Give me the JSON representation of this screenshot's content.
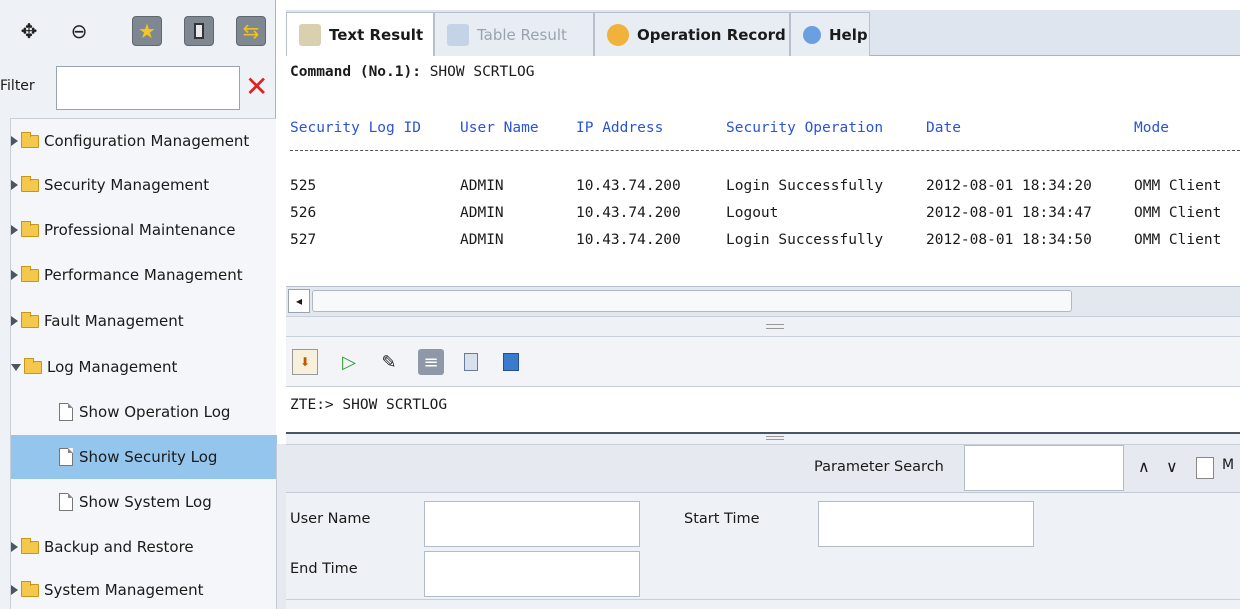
{
  "left_toolbar": {
    "icons": [
      "expand-icon",
      "collapse-icon",
      "favorites-icon",
      "device-icon",
      "switch-icon"
    ]
  },
  "filter": {
    "label": "Filter",
    "value": ""
  },
  "tree": [
    {
      "label": "Configuration Management",
      "type": "folder",
      "expanded": false
    },
    {
      "label": "Security Management",
      "type": "folder",
      "expanded": false
    },
    {
      "label": "Professional Maintenance",
      "type": "folder",
      "expanded": false
    },
    {
      "label": "Performance Management",
      "type": "folder",
      "expanded": false
    },
    {
      "label": "Fault Management",
      "type": "folder",
      "expanded": false
    },
    {
      "label": "Log Management",
      "type": "folder",
      "expanded": true
    },
    {
      "label": "Show Operation Log",
      "type": "doc"
    },
    {
      "label": "Show Security Log",
      "type": "doc",
      "selected": true
    },
    {
      "label": "Show System Log",
      "type": "doc"
    },
    {
      "label": "Backup and Restore",
      "type": "folder",
      "expanded": false
    },
    {
      "label": "System Management",
      "type": "folder",
      "expanded": false
    }
  ],
  "tabs": [
    {
      "label": "Text Result",
      "active": true
    },
    {
      "label": "Table Result",
      "disabled": true
    },
    {
      "label": "Operation Record"
    },
    {
      "label": "Help"
    }
  ],
  "result": {
    "command_prefix": "Command (No.1):",
    "command": "SHOW SCRTLOG",
    "headers": [
      "Security Log ID",
      "User Name",
      "IP Address",
      "Security Operation",
      "Date",
      "Mode"
    ],
    "rows": [
      [
        "525",
        "ADMIN",
        "10.43.74.200",
        "Login Successfully",
        "2012-08-01 18:34:20",
        "OMM Client"
      ],
      [
        "526",
        "ADMIN",
        "10.43.74.200",
        "Logout",
        "2012-08-01 18:34:47",
        "OMM Client"
      ],
      [
        "527",
        "ADMIN",
        "10.43.74.200",
        "Login Successfully",
        "2012-08-01 18:34:50",
        "OMM Client"
      ]
    ]
  },
  "command_input": "ZTE:> SHOW SCRTLOG",
  "params": {
    "search_label": "Parameter Search",
    "search_value": "",
    "more": "M",
    "fields": {
      "user_name": {
        "label": "User Name",
        "value": ""
      },
      "start_time": {
        "label": "Start Time",
        "value": ""
      },
      "end_time": {
        "label": "End Time",
        "value": ""
      }
    }
  },
  "colors": {
    "header_blue": "#2a54d6",
    "selected_row": "#94c5ec",
    "clear_red": "#dd2222"
  }
}
